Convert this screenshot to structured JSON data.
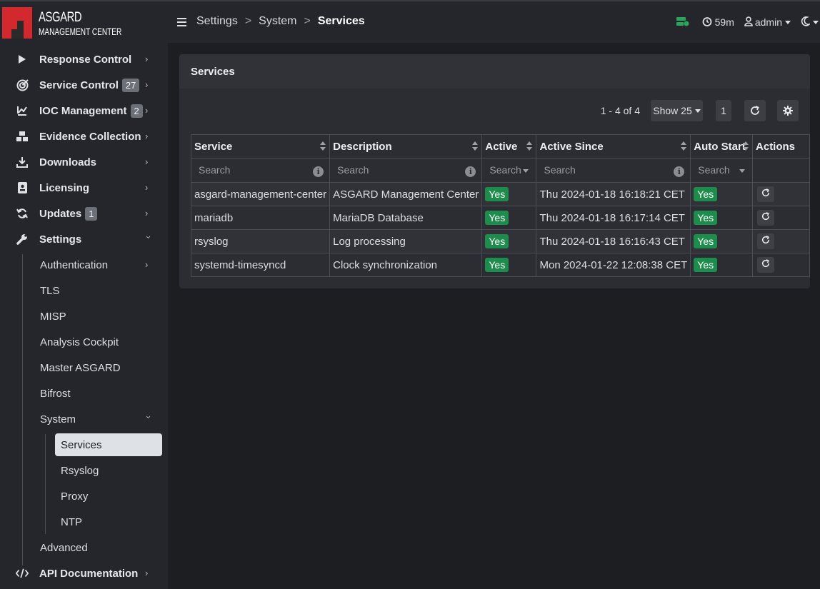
{
  "app": {
    "name_line1": "ASGARD",
    "name_line2": "MANAGEMENT CENTER"
  },
  "sidebar": {
    "items": [
      {
        "label": "Response Control",
        "icon": "play-icon"
      },
      {
        "label": "Service Control",
        "badge": "27",
        "icon": "crosshair-icon"
      },
      {
        "label": "IOC Management",
        "badge": "2",
        "icon": "file-chart-icon"
      },
      {
        "label": "Evidence Collection",
        "icon": "boxes-icon"
      },
      {
        "label": "Downloads",
        "icon": "download-icon"
      },
      {
        "label": "Licensing",
        "icon": "id-card-icon"
      },
      {
        "label": "Updates",
        "badge": "1",
        "icon": "sync-icon"
      },
      {
        "label": "Settings",
        "icon": "wrench-icon"
      },
      {
        "label": "API Documentation",
        "icon": "code-icon"
      }
    ],
    "settings_sub": [
      "Authentication",
      "TLS",
      "MISP",
      "Analysis Cockpit",
      "Master ASGARD",
      "Bifrost",
      "System",
      "Advanced"
    ],
    "system_sub": [
      "Services",
      "Rsyslog",
      "Proxy",
      "NTP"
    ]
  },
  "header": {
    "breadcrumb": [
      "Settings",
      "System",
      "Services"
    ],
    "breadcrumb_sep": ">",
    "session_timer": "59m",
    "user": "admin"
  },
  "card": {
    "title": "Services",
    "range": "1 - 4 of 4",
    "show": "Show 25",
    "page": "1"
  },
  "table": {
    "headers": [
      "Service",
      "Description",
      "Active",
      "Active Since",
      "Auto Start",
      "Actions"
    ],
    "search_placeholder": "Search",
    "rows": [
      {
        "service": "asgard-management-center",
        "description": "ASGARD Management Center",
        "active": "Yes",
        "since": "Thu 2024-01-18 16:18:21 CET",
        "autostart": "Yes"
      },
      {
        "service": "mariadb",
        "description": "MariaDB Database",
        "active": "Yes",
        "since": "Thu 2024-01-18 16:17:14 CET",
        "autostart": "Yes"
      },
      {
        "service": "rsyslog",
        "description": "Log processing",
        "active": "Yes",
        "since": "Thu 2024-01-18 16:16:43 CET",
        "autostart": "Yes"
      },
      {
        "service": "systemd-timesyncd",
        "description": "Clock synchronization",
        "active": "Yes",
        "since": "Mon 2024-01-22 12:08:38 CET",
        "autostart": "Yes"
      }
    ]
  },
  "colors": {
    "accent": "#d2282e",
    "success": "#1e8c4c",
    "sidebar": "#24262b",
    "background": "#1d1e22"
  }
}
